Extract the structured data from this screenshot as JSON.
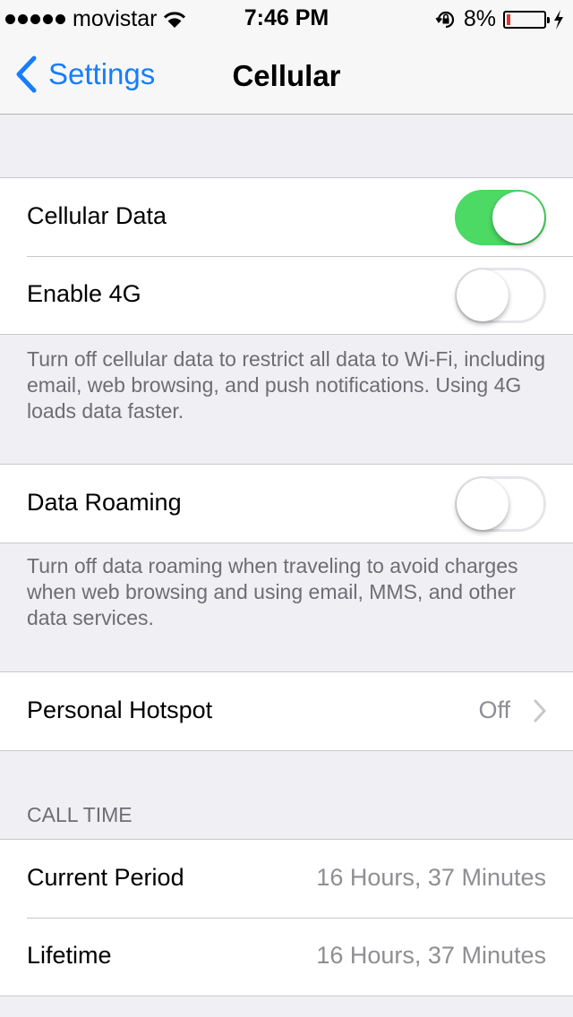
{
  "status_bar": {
    "carrier": "movistar",
    "time": "7:46 PM",
    "battery_percent": "8%",
    "signal_bars": 5,
    "icons": [
      "signal-dots-icon",
      "wifi-icon",
      "rotation-lock-icon",
      "battery-icon",
      "charging-bolt-icon"
    ],
    "battery_color": "#e0372f"
  },
  "nav": {
    "back_label": "Settings",
    "title": "Cellular",
    "accent_color": "#157efb"
  },
  "cellular": {
    "cellular_data_label": "Cellular Data",
    "cellular_data_on": true,
    "enable_4g_label": "Enable 4G",
    "enable_4g_on": false,
    "footnote": "Turn off cellular data to restrict all data to Wi-Fi, including email, web browsing, and push notifications. Using 4G loads data faster."
  },
  "roaming": {
    "label": "Data Roaming",
    "on": false,
    "footnote": "Turn off data roaming when traveling to avoid charges when web browsing and using email, MMS, and other data services."
  },
  "hotspot": {
    "label": "Personal Hotspot",
    "value": "Off"
  },
  "call_time": {
    "header": "CALL TIME",
    "rows": [
      {
        "label": "Current Period",
        "value": "16 Hours, 37 Minutes"
      },
      {
        "label": "Lifetime",
        "value": "16 Hours, 37 Minutes"
      }
    ]
  },
  "colors": {
    "toggle_on": "#4cd964",
    "background": "#efeff4"
  }
}
